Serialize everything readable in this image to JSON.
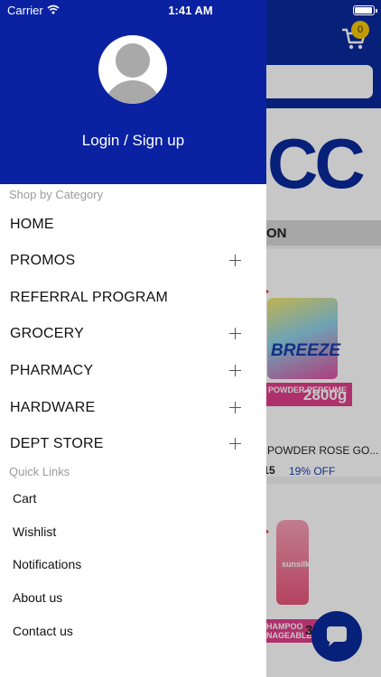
{
  "status_bar": {
    "carrier": "Carrier",
    "time": "1:41 AM",
    "battery_level": 0.95
  },
  "background": {
    "cart_badge": "0",
    "logo_fragment": "CC",
    "section_title_fragment": "ON",
    "products": [
      {
        "brand_fragment": "BREEZE",
        "label_fragment": "POWDER PERFUME",
        "size": "2800g",
        "name_fragment": "POWDER ROSE GO...",
        "price_fragment": ".15",
        "discount": "19% OFF"
      },
      {
        "brand_fragment": "sunsilk",
        "label_fragment": "HAMPOO NAGEABLE",
        "number_fragment": "3"
      }
    ],
    "colors": {
      "brand_blue": "#0a2a9c",
      "badge_yellow": "#f6c800",
      "promo_pink": "#e13f8b"
    }
  },
  "drawer": {
    "login_label": "Login / Sign up",
    "category_heading": "Shop by Category",
    "categories": [
      {
        "label": "HOME",
        "expandable": false
      },
      {
        "label": "PROMOS",
        "expandable": true
      },
      {
        "label": "REFERRAL PROGRAM",
        "expandable": false
      },
      {
        "label": "GROCERY",
        "expandable": true
      },
      {
        "label": "PHARMACY",
        "expandable": true
      },
      {
        "label": "HARDWARE",
        "expandable": true
      },
      {
        "label": "DEPT STORE",
        "expandable": true
      }
    ],
    "quick_links_heading": "Quick Links",
    "quick_links": [
      {
        "label": "Cart"
      },
      {
        "label": "Wishlist"
      },
      {
        "label": "Notifications"
      },
      {
        "label": "About us"
      },
      {
        "label": "Contact us"
      }
    ],
    "colors": {
      "header_blue": "#0a22a2"
    }
  }
}
